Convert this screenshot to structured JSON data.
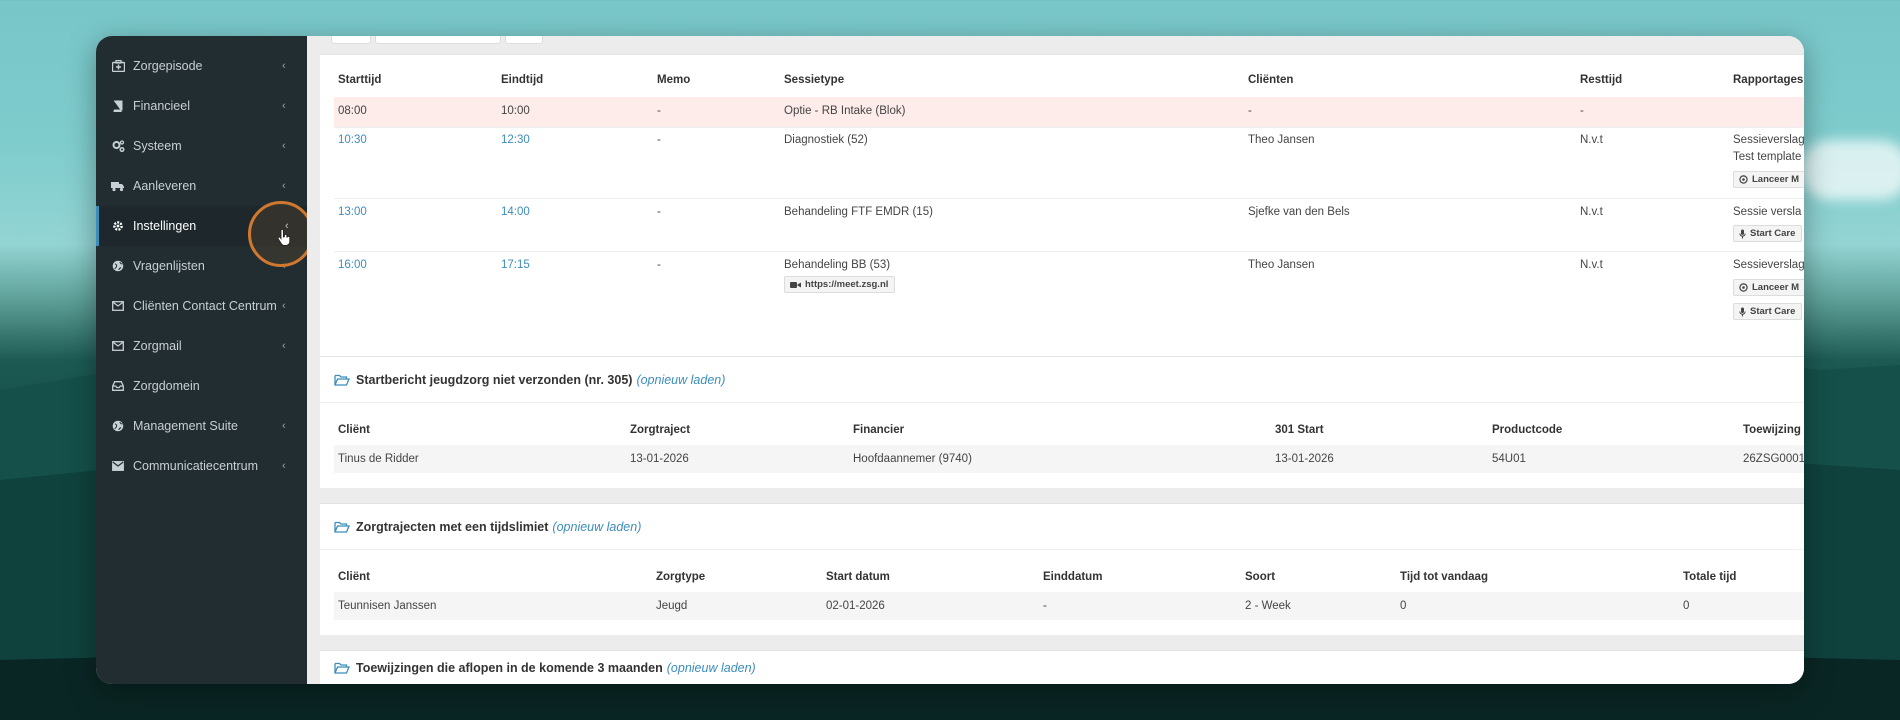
{
  "colors": {
    "accent": "#3c8dbc",
    "sidebar_bg": "#222d32",
    "highlight": "#d0782f",
    "row_block": "#fdecea"
  },
  "sidebar": {
    "items": [
      {
        "label": "Zorgepisode",
        "icon": "briefcase-medical-icon",
        "has_chevron": true
      },
      {
        "label": "Financieel",
        "icon": "book-icon",
        "has_chevron": true
      },
      {
        "label": "Systeem",
        "icon": "cogs-icon",
        "has_chevron": true
      },
      {
        "label": "Aanleveren",
        "icon": "truck-icon",
        "has_chevron": true
      },
      {
        "label": "Instellingen",
        "icon": "gear-icon",
        "has_chevron": true,
        "active": true
      },
      {
        "label": "Vragenlijsten",
        "icon": "globe-icon",
        "has_chevron": true
      },
      {
        "label": "Cliënten Contact Centrum",
        "icon": "envelope-icon",
        "has_chevron": true
      },
      {
        "label": "Zorgmail",
        "icon": "envelope-icon",
        "has_chevron": true
      },
      {
        "label": "Zorgdomein",
        "icon": "inbox-icon",
        "has_chevron": false
      },
      {
        "label": "Management Suite",
        "icon": "globe-icon",
        "has_chevron": true
      },
      {
        "label": "Communicatiecentrum",
        "icon": "envelope-icon",
        "has_chevron": true
      }
    ]
  },
  "sessions": {
    "headers": [
      "Starttijd",
      "Eindtijd",
      "Memo",
      "Sessietype",
      "Cliënten",
      "Resttijd",
      "Rapportages"
    ],
    "rows": [
      {
        "start": "08:00",
        "end": "10:00",
        "memo": "-",
        "type": "Optie - RB Intake (Blok)",
        "client": "-",
        "rest": "-",
        "reports": []
      },
      {
        "start": "10:30",
        "end": "12:30",
        "memo": "-",
        "type": "Diagnostiek (52)",
        "client": "Theo Jansen",
        "rest": "N.v.t",
        "reports": [
          "Sessieverslag",
          "Test template"
        ],
        "buttons": [
          "Lanceer M"
        ]
      },
      {
        "start": "13:00",
        "end": "14:00",
        "memo": "-",
        "type": "Behandeling FTF EMDR (15)",
        "client": "Sjefke van den Bels",
        "rest": "N.v.t",
        "reports": [
          "Sessie versla"
        ],
        "buttons": [
          "Start Care"
        ]
      },
      {
        "start": "16:00",
        "end": "17:15",
        "memo": "-",
        "type": "Behandeling BB (53)",
        "meet_link": "https://meet.zsg.nl",
        "client": "Theo Jansen",
        "rest": "N.v.t",
        "reports": [
          "Sessieverslag"
        ],
        "buttons": [
          "Lanceer M",
          "Start Care"
        ]
      }
    ]
  },
  "startbericht": {
    "title": "Startbericht jeugdzorg niet verzonden (nr. 305)",
    "reload": "(opnieuw laden)",
    "headers": [
      "Cliënt",
      "Zorgtraject",
      "Financier",
      "301 Start",
      "Productcode",
      "Toewijzing"
    ],
    "rows": [
      {
        "client": "Tinus de Ridder",
        "traject": "13-01-2026",
        "financier": "Hoofdaannemer (9740)",
        "start": "13-01-2026",
        "code": "54U01",
        "toewijzing": "26ZSG0001"
      }
    ]
  },
  "tijdslimiet": {
    "title": "Zorgtrajecten met een tijdslimiet",
    "reload": "(opnieuw laden)",
    "headers": [
      "Cliënt",
      "Zorgtype",
      "Start datum",
      "Einddatum",
      "Soort",
      "Tijd tot vandaag",
      "Totale tijd"
    ],
    "rows": [
      {
        "client": "Teunnisen Janssen",
        "type": "Jeugd",
        "start": "02-01-2026",
        "end": "-",
        "soort": "2 - Week",
        "tijd": "0",
        "totaal": "0"
      }
    ]
  },
  "toewijzingen": {
    "title": "Toewijzingen die aflopen in de komende 3 maanden",
    "reload": "(opnieuw laden)"
  }
}
